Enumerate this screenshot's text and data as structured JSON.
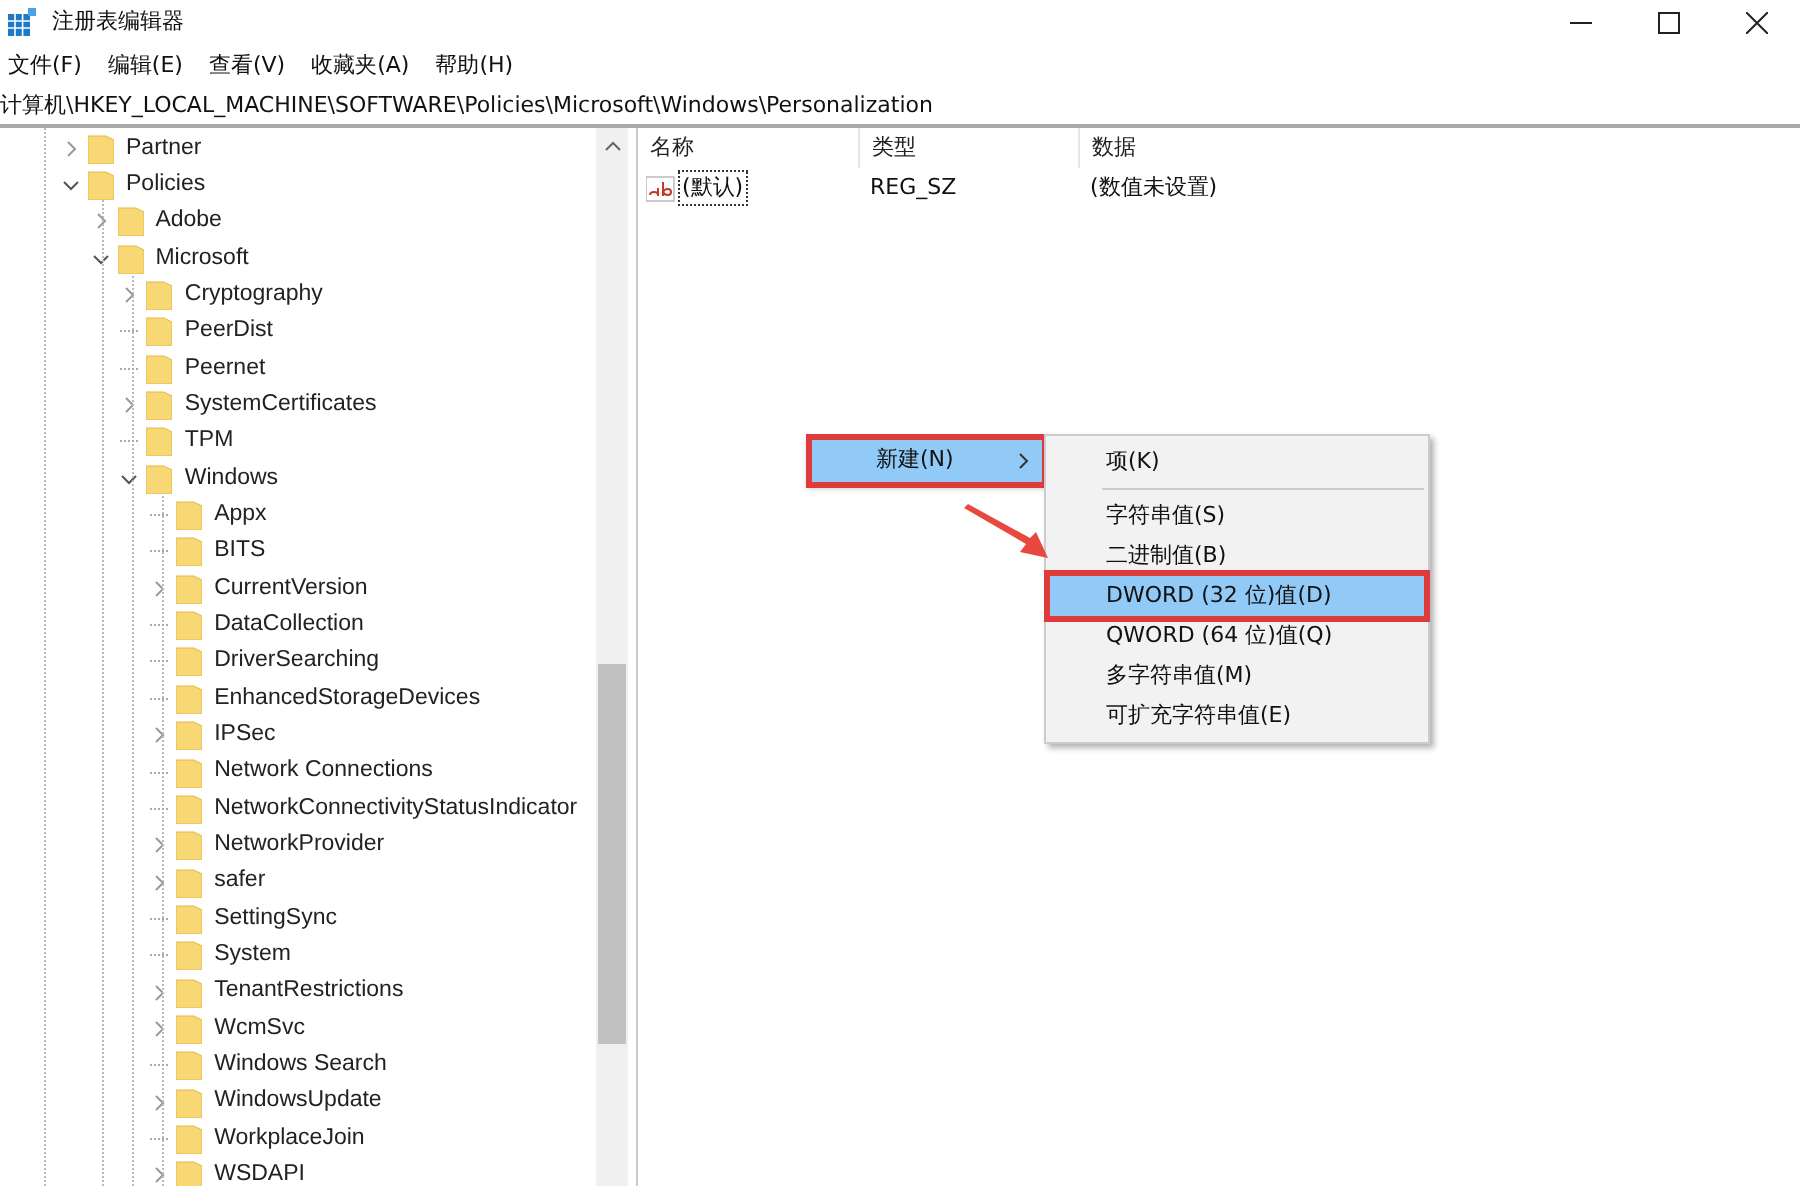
{
  "window": {
    "title": "注册表编辑器"
  },
  "menu_bar": [
    "文件(F)",
    "编辑(E)",
    "查看(V)",
    "收藏夹(A)",
    "帮助(H)"
  ],
  "address_bar": {
    "value": "计算机\\HKEY_LOCAL_MACHINE\\SOFTWARE\\Policies\\Microsoft\\Windows\\Personalization"
  },
  "tree": [
    {
      "label": "Partner",
      "kind": "collapsed"
    },
    {
      "label": "Policies",
      "kind": "expanded",
      "children": [
        {
          "label": "Adobe",
          "kind": "collapsed"
        },
        {
          "label": "Microsoft",
          "kind": "expanded",
          "children": [
            {
              "label": "Cryptography",
              "kind": "collapsed"
            },
            {
              "label": "PeerDist",
              "kind": "leaf"
            },
            {
              "label": "Peernet",
              "kind": "leaf"
            },
            {
              "label": "SystemCertificates",
              "kind": "collapsed"
            },
            {
              "label": "TPM",
              "kind": "leaf"
            },
            {
              "label": "Windows",
              "kind": "expanded",
              "children": [
                {
                  "label": "Appx",
                  "kind": "leaf"
                },
                {
                  "label": "BITS",
                  "kind": "leaf"
                },
                {
                  "label": "CurrentVersion",
                  "kind": "collapsed"
                },
                {
                  "label": "DataCollection",
                  "kind": "leaf"
                },
                {
                  "label": "DriverSearching",
                  "kind": "leaf"
                },
                {
                  "label": "EnhancedStorageDevices",
                  "kind": "leaf"
                },
                {
                  "label": "IPSec",
                  "kind": "collapsed"
                },
                {
                  "label": "Network Connections",
                  "kind": "leaf"
                },
                {
                  "label": "NetworkConnectivityStatusIndicator",
                  "kind": "leaf"
                },
                {
                  "label": "NetworkProvider",
                  "kind": "collapsed"
                },
                {
                  "label": "safer",
                  "kind": "collapsed"
                },
                {
                  "label": "SettingSync",
                  "kind": "leaf"
                },
                {
                  "label": "System",
                  "kind": "leaf"
                },
                {
                  "label": "TenantRestrictions",
                  "kind": "collapsed"
                },
                {
                  "label": "WcmSvc",
                  "kind": "collapsed"
                },
                {
                  "label": "Windows Search",
                  "kind": "leaf"
                },
                {
                  "label": "WindowsUpdate",
                  "kind": "collapsed"
                },
                {
                  "label": "WorkplaceJoin",
                  "kind": "leaf"
                },
                {
                  "label": "WSDAPI",
                  "kind": "collapsed"
                }
              ]
            }
          ]
        }
      ]
    }
  ],
  "list": {
    "columns": [
      "名称",
      "类型",
      "数据"
    ],
    "rows": [
      {
        "name": "(默认)",
        "type": "REG_SZ",
        "data": "(数值未设置)",
        "selected": true
      }
    ]
  },
  "context_menu": {
    "items": [
      {
        "label": "新建(N)",
        "selected": true,
        "callout": true
      }
    ]
  },
  "submenu": {
    "items": [
      {
        "label": "项(K)",
        "selected": false,
        "callout": false,
        "separator_after": true
      },
      {
        "label": "字符串值(S)",
        "selected": false,
        "callout": false,
        "separator_after": false
      },
      {
        "label": "二进制值(B)",
        "selected": false,
        "callout": false,
        "separator_after": false
      },
      {
        "label": "DWORD (32 位)值(D)",
        "selected": true,
        "callout": true,
        "separator_after": false
      },
      {
        "label": "QWORD (64 位)值(Q)",
        "selected": false,
        "callout": false,
        "separator_after": false
      },
      {
        "label": "多字符串值(M)",
        "selected": false,
        "callout": false,
        "separator_after": false
      },
      {
        "label": "可扩充字符串值(E)",
        "selected": false,
        "callout": false,
        "separator_after": false
      }
    ]
  }
}
